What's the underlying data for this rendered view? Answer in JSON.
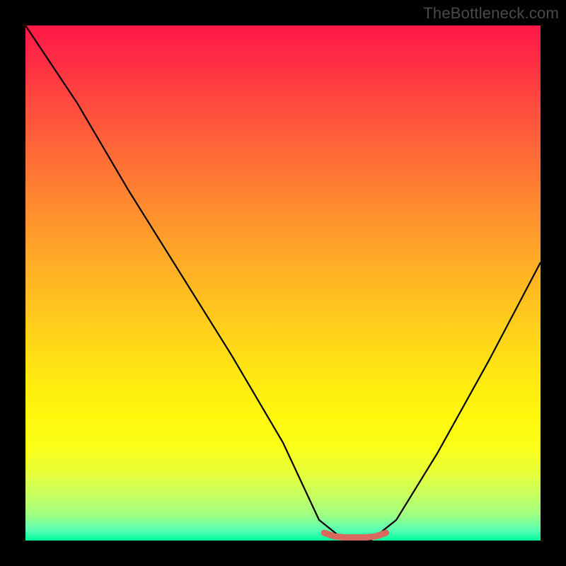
{
  "watermark": "TheBottleneck.com",
  "chart_data": {
    "type": "line",
    "title": "",
    "xlabel": "",
    "ylabel": "",
    "xlim": [
      0,
      100
    ],
    "ylim": [
      0,
      100
    ],
    "grid": false,
    "legend": false,
    "series": [
      {
        "name": "bottleneck-curve",
        "x": [
          0,
          10,
          20,
          30,
          40,
          50,
          57,
          62,
          67,
          72,
          80,
          90,
          100
        ],
        "values": [
          100,
          85,
          68,
          52,
          36,
          19,
          4,
          0,
          0,
          4,
          17,
          35,
          54
        ]
      },
      {
        "name": "optimal-range-marker",
        "x": [
          58,
          60,
          62,
          64,
          66,
          68,
          70
        ],
        "values": [
          1.5,
          0.8,
          0.6,
          0.6,
          0.6,
          0.8,
          1.5
        ]
      }
    ],
    "colors": {
      "curve": "#000000",
      "marker": "#d9695f",
      "gradient_top": "#ff1846",
      "gradient_bottom": "#00ff9c"
    }
  }
}
